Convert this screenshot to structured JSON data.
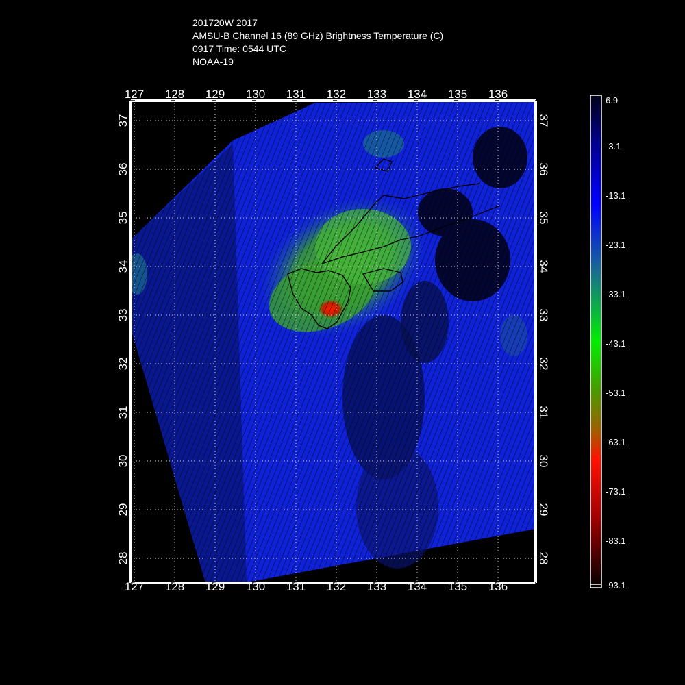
{
  "header": {
    "line1": "201720W 2017",
    "line2": "AMSU-B Channel 16 (89 GHz) Brightness Temperature (C)",
    "line3": "0917 Time: 0544 UTC",
    "line4": "NOAA-19"
  },
  "map": {
    "lon_labels": [
      "127",
      "128",
      "129",
      "130",
      "131",
      "132",
      "133",
      "134",
      "135",
      "136"
    ],
    "lat_labels": [
      "37",
      "36",
      "35",
      "34",
      "33",
      "32",
      "31",
      "30",
      "29",
      "28"
    ],
    "lon_range": [
      126.95,
      137.0
    ],
    "lat_range": [
      27.4,
      37.4
    ]
  },
  "colorbar": {
    "labels": [
      "6.9",
      "-3.1",
      "-13.1",
      "-23.1",
      "-33.1",
      "-43.1",
      "-53.1",
      "-63.1",
      "-73.1",
      "-83.1",
      "-93.1"
    ],
    "colors": {
      "top": "#000010",
      "blue": "#0000ff",
      "teal": "#1a7090",
      "green": "#00e000",
      "olive": "#8a7a00",
      "red": "#ff0000",
      "darkred": "#800000",
      "bottom": "#000000"
    }
  }
}
